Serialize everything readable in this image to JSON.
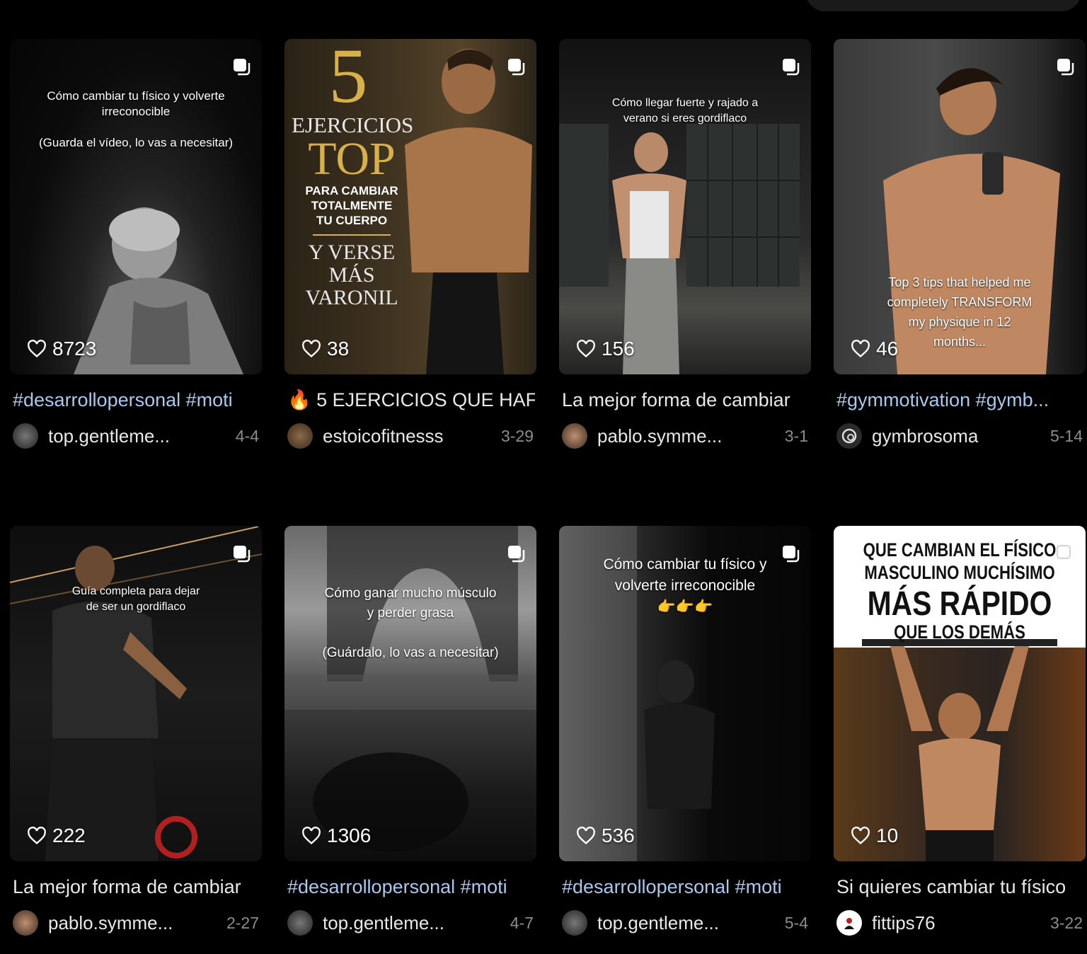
{
  "cards": [
    {
      "overlay": "Cómo cambiar tu físico y volverte\nirreconocible\n\n(Guarda el vídeo, lo vas a necesitar)",
      "likes": "8723",
      "caption": "#desarrollopersonal #moti",
      "username": "top.gentleme...",
      "date": "4-4"
    },
    {
      "poster": {
        "number": "5",
        "line1": "EJERCICIOS",
        "line2": "TOP",
        "line3": "PARA CAMBIAR\nTOTALMENTE\nTU CUERPO",
        "line4": "Y VERSE\nMÁS\nVARONIL"
      },
      "likes": "38",
      "caption": "🔥 5 EJERCICIOS QUE HAF",
      "username": "estoicofitnesss",
      "date": "3-29"
    },
    {
      "overlay": "Cómo llegar fuerte y rajado a\nverano si eres gordiflaco",
      "likes": "156",
      "caption": "La mejor forma de cambiar",
      "username": "pablo.symme...",
      "date": "3-1"
    },
    {
      "overlay": "Top 3 tips that helped me\ncompletely TRANSFORM\nmy physique in 12\nmonths...",
      "likes": "46",
      "caption": "#gymmotivation #gymb...",
      "username": "gymbrosoma",
      "date": "5-14"
    },
    {
      "overlay": "Guía completa para dejar\nde ser un gordiflaco",
      "likes": "222",
      "caption": "La mejor forma de cambiar",
      "username": "pablo.symme...",
      "date": "2-27"
    },
    {
      "overlay": "Cómo ganar mucho músculo\ny perder grasa\n\n(Guárdalo, lo vas a necesitar)",
      "likes": "1306",
      "caption": "#desarrollopersonal #moti",
      "username": "top.gentleme...",
      "date": "4-7"
    },
    {
      "overlay": "Cómo cambiar tu físico y\nvolverte irreconocible\n👉👉👉",
      "likes": "536",
      "caption": "#desarrollopersonal #moti",
      "username": "top.gentleme...",
      "date": "5-4"
    },
    {
      "poster": {
        "line1": "QUE CAMBIAN EL FÍSICO\nMASCULINO MUCHÍSIMO",
        "line2": "MÁS RÁPIDO",
        "line3": "QUE LOS DEMÁS"
      },
      "likes": "10",
      "caption": "Si quieres cambiar tu físico",
      "username": "fittips76",
      "date": "3-22"
    }
  ],
  "icons": {
    "like": "heart-outline-icon",
    "multi": "multi-photo-icon"
  },
  "colors": {
    "background": "#000000",
    "hashtag": "#a9c7ef",
    "date": "#8c8c8c",
    "text": "#e8e8e8"
  }
}
